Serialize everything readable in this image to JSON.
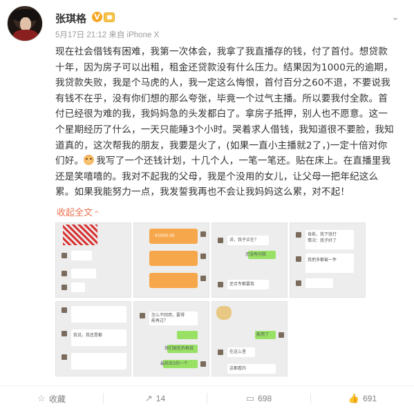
{
  "user": {
    "name": "张琪格",
    "verified_mark": "V",
    "meta": "5月17日 21:12 来自 iPhone X"
  },
  "post": {
    "line1": "现在社会借钱有困难，我第一次体会，我拿了我直播存的钱，付了首付。想贷款",
    "line2": "十年，因为房子可以出租，租金还贷款没有什么压力。结果因为1000元的逾期，",
    "line3": "我贷款失败，我是个马虎的人，我一定这么悔恨，首付百分之60不退，不要说我",
    "line4": "有钱不在乎，没有你们想的那么夸张，毕竟一个过气主播。所以要我付全款。首",
    "line5": "付已经很为难的我，我妈妈急的头发都白了。拿房子抵押，别人也不愿意。这一",
    "line6": "个星期经历了什么，一天只能睡3个小时。哭着求人借钱，我知道很不要脸，我知",
    "line7": "道真的，这次帮我的朋友，我要是火了，(如果一直小主播就2了，)一定十倍对你",
    "line8_a": "们好。",
    "line8_b": "我写了一个还钱计划，十几个人，一笔一笔还。贴在床上。在直播里我",
    "line9": "还是笑嘻嘻的。我对不起我的父母，我是个没用的女儿，让父母一把年纪这么",
    "line10": "累。如果我能努力一点，我发誓我再也不会让我妈妈这么累，对不起！",
    "collapse_label": "收起全文",
    "collapse_arrow": "^"
  },
  "images": {
    "t2_amount": "¥1000.00",
    "t3_a": "说，我子买在？",
    "t3_b": "还没有问我",
    "t3_c": "还合专都要我",
    "t4_a": "肯能，我下班打",
    "t4_b": "情况：我子好了",
    "t4_c": "我把多都被一件",
    "t5_a": "我说，我还是都",
    "t6_a": "怎么不回用，要得",
    "t6_b": "能再过？",
    "t6_c": "我们现在的地说",
    "t6_d": "最后合2的一个",
    "t7_a": "能用了",
    "t7_b": "在这么里",
    "t7_c": "这都看的"
  },
  "actions": {
    "favorite": "收藏",
    "repost": "14",
    "comment": "698",
    "like": "691"
  },
  "icons": {
    "favorite": "☆",
    "repost": "↗",
    "comment": "▭",
    "like": "👍",
    "more": "⌄"
  },
  "colors": {
    "accent": "#eb7350",
    "verified": "#f5a623"
  }
}
